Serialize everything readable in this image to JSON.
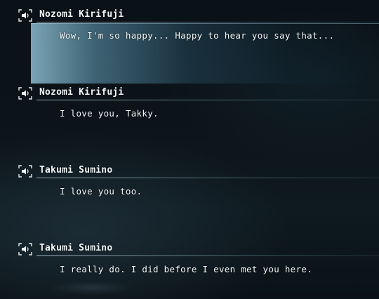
{
  "backlog": [
    {
      "speaker": "Nozomi Kirifuji",
      "text": "Wow, I'm so happy... Happy to hear you say that...",
      "voice_icon": "speaker-icon",
      "selected": true
    },
    {
      "speaker": "Nozomi Kirifuji",
      "text": "I love you, Takky.",
      "voice_icon": "speaker-icon",
      "selected": false
    },
    {
      "speaker": "Takumi Sumino",
      "text": "I love you too.",
      "voice_icon": "speaker-icon",
      "selected": false
    },
    {
      "speaker": "Takumi Sumino",
      "text": "I really do. I did before I even met you here.",
      "voice_icon": "speaker-icon",
      "selected": false
    }
  ],
  "colors": {
    "highlight": "#5f96af",
    "text": "#f4f8fa",
    "background": "#0c1419"
  }
}
